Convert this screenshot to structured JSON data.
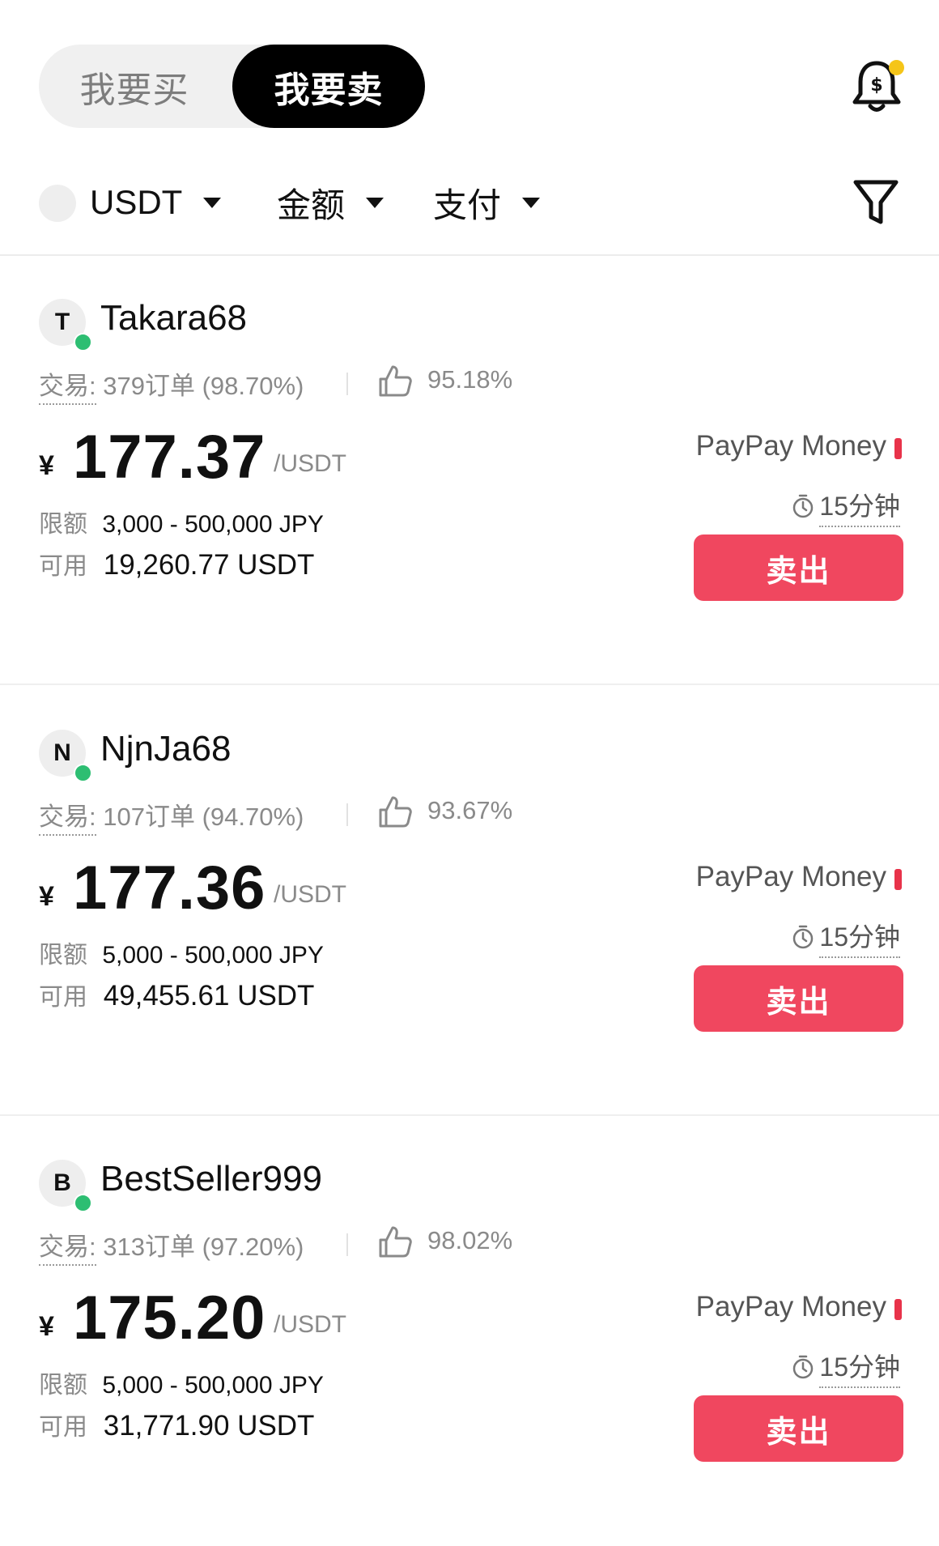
{
  "tabs": {
    "buy_label": "我要买",
    "sell_label": "我要卖"
  },
  "filters": {
    "coin": "USDT",
    "amount": "金额",
    "payment": "支付"
  },
  "listings": [
    {
      "initial": "T",
      "username": "Takara68",
      "stats_label": "交易:",
      "stats_value": "379订单 (98.70%)",
      "rating": "95.18%",
      "currency_symbol": "¥",
      "price": "177.37",
      "unit": "/USDT",
      "limit_label": "限额",
      "limit_value": "3,000 - 500,000 JPY",
      "available_label": "可用",
      "available_value": "19,260.77 USDT",
      "payment": "PayPay Money",
      "time_limit": "15分钟",
      "action": "卖出"
    },
    {
      "initial": "N",
      "username": "NjnJa68",
      "stats_label": "交易:",
      "stats_value": "107订单 (94.70%)",
      "rating": "93.67%",
      "currency_symbol": "¥",
      "price": "177.36",
      "unit": "/USDT",
      "limit_label": "限额",
      "limit_value": "5,000 - 500,000 JPY",
      "available_label": "可用",
      "available_value": "49,455.61 USDT",
      "payment": "PayPay Money",
      "time_limit": "15分钟",
      "action": "卖出"
    },
    {
      "initial": "B",
      "username": "BestSeller999",
      "stats_label": "交易:",
      "stats_value": "313订单 (97.20%)",
      "rating": "98.02%",
      "currency_symbol": "¥",
      "price": "175.20",
      "unit": "/USDT",
      "limit_label": "限额",
      "limit_value": "5,000 - 500,000 JPY",
      "available_label": "可用",
      "available_value": "31,771.90 USDT",
      "payment": "PayPay Money",
      "time_limit": "15分钟",
      "action": "卖出"
    }
  ],
  "colors": {
    "sell_button": "#f0475f",
    "online_dot": "#2dbe72",
    "notification_dot": "#f5c518",
    "payment_marker": "#e8334a"
  },
  "icons": [
    "bell-dollar-icon",
    "caret-down-icon",
    "filter-funnel-icon",
    "thumbs-up-icon",
    "timer-icon"
  ]
}
